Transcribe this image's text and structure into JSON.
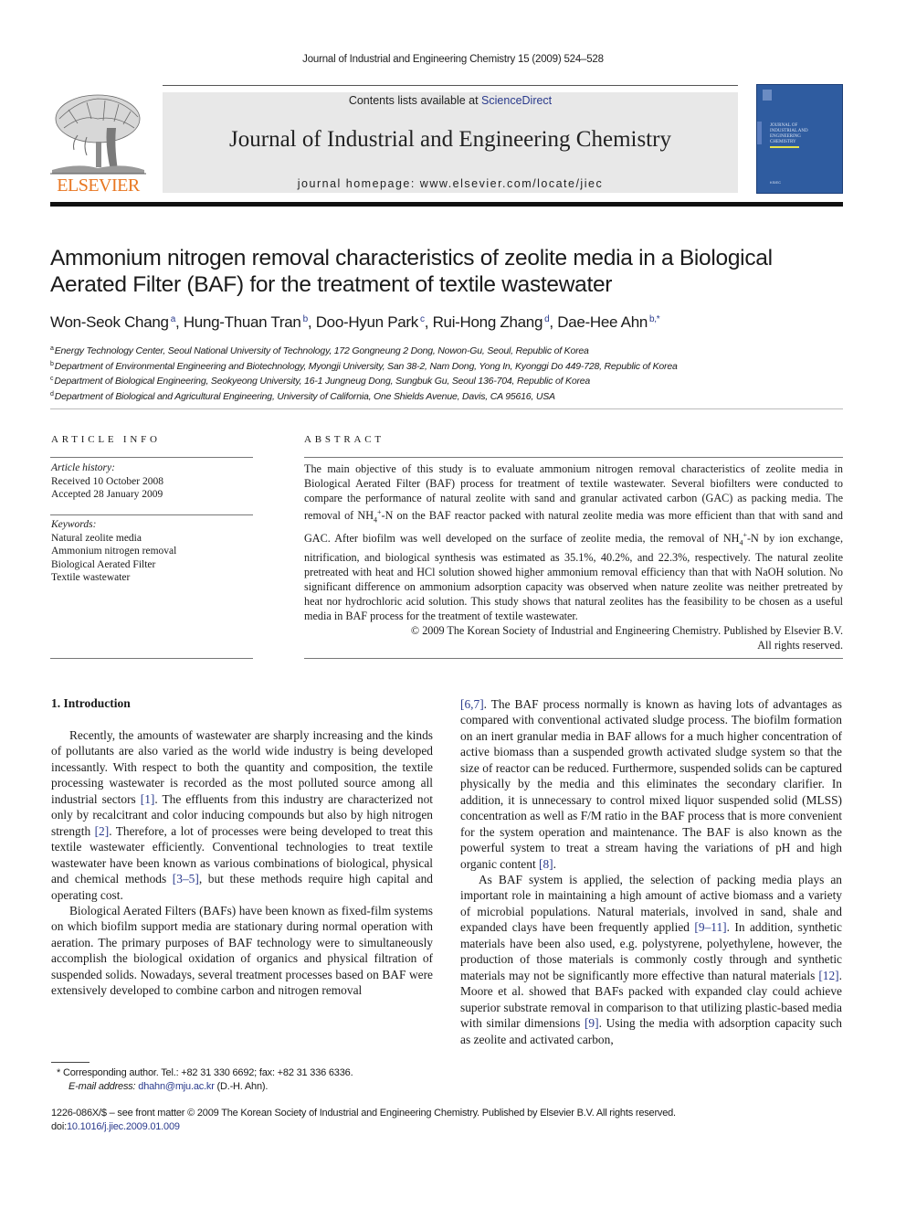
{
  "running_header": "Journal of Industrial and Engineering Chemistry 15 (2009) 524–528",
  "masthead": {
    "publisher_logo_text": "ELSEVIER",
    "contents_prefix": "Contents lists available at ",
    "contents_link": "ScienceDirect",
    "journal_title": "Journal of Industrial and Engineering Chemistry",
    "homepage": "journal homepage: www.elsevier.com/locate/jiec",
    "cover_title": "Journal of Industrial and Engineering Chemistry",
    "colors": {
      "logo_orange": "#e87722",
      "cover_blue": "#2f5ca0",
      "link_blue": "#2a3a8c",
      "banner_gray": "#e8e8e8"
    }
  },
  "article": {
    "title_line1": "Ammonium nitrogen removal characteristics of zeolite media in a Biological",
    "title_line2": "Aerated Filter (BAF) for the treatment of textile wastewater",
    "authors": [
      {
        "name": "Won-Seok Chang",
        "sup": "a",
        "sep": ", "
      },
      {
        "name": "Hung-Thuan Tran",
        "sup": "b",
        "sep": ", "
      },
      {
        "name": "Doo-Hyun Park",
        "sup": "c",
        "sep": ", "
      },
      {
        "name": "Rui-Hong Zhang",
        "sup": "d",
        "sep": ", "
      },
      {
        "name": "Dae-Hee Ahn",
        "sup": "b,*",
        "sep": ""
      }
    ],
    "affiliations": [
      {
        "key": "a",
        "text": "Energy Technology Center, Seoul National University of Technology, 172 Gongneung 2 Dong, Nowon-Gu, Seoul, Republic of Korea"
      },
      {
        "key": "b",
        "text": "Department of Environmental Engineering and Biotechnology, Myongji University, San 38-2, Nam Dong, Yong In, Kyonggi Do 449-728, Republic of Korea"
      },
      {
        "key": "c",
        "text": "Department of Biological Engineering, Seokyeong University, 16-1 Jungneug Dong, Sungbuk Gu, Seoul 136-704, Republic of Korea"
      },
      {
        "key": "d",
        "text": "Department of Biological and Agricultural Engineering, University of California, One Shields Avenue, Davis, CA 95616, USA"
      }
    ]
  },
  "article_info": {
    "heading": "ARTICLE INFO",
    "history_label": "Article history:",
    "received": "Received 10 October 2008",
    "accepted": "Accepted 28 January 2009",
    "keywords_label": "Keywords:",
    "keywords": [
      "Natural zeolite media",
      "Ammonium nitrogen removal",
      "Biological Aerated Filter",
      "Textile wastewater"
    ]
  },
  "abstract": {
    "heading": "ABSTRACT",
    "p1": "The main objective of this study is to evaluate ammonium nitrogen removal characteristics of zeolite media in Biological Aerated Filter (BAF) process for treatment of textile wastewater. Several biofilters were conducted to compare the performance of natural zeolite with sand and granular activated carbon (GAC) as packing media. The removal of ",
    "p2": " on the BAF reactor packed with natural zeolite media was more efficient than that with sand and GAC. After biofilm was well developed on the surface of zeolite media, the removal of ",
    "p3": " by ion exchange, nitrification, and biological synthesis was estimated as 35.1%, 40.2%, and 22.3%, respectively. The natural zeolite pretreated with heat and HCl solution showed higher ammonium removal efficiency than that with NaOH solution. No significant difference on ammonium adsorption capacity was observed when nature zeolite was neither pretreated by heat nor hydrochloric acid solution. This study shows that natural zeolites has the feasibility to be chosen as a useful media in BAF process for the treatment of textile wastewater.",
    "nh4_base": "NH",
    "nh4_sub": "4",
    "nh4_sup": "+",
    "nh4_suffix": "-N",
    "copyright_line1": "© 2009 The Korean Society of Industrial and Engineering Chemistry. Published by Elsevier B.V.",
    "copyright_line2": "All rights reserved."
  },
  "body": {
    "section_heading": "1.  Introduction",
    "left": {
      "p1_a": "Recently, the amounts of wastewater are sharply increasing and the kinds of pollutants are also varied as the world wide industry is being developed incessantly. With respect to both the quantity and composition, the textile processing wastewater is recorded as the most polluted source among all industrial sectors ",
      "ref1": "[1]",
      "p1_b": ". The effluents from this industry are characterized not only by recalcitrant and color inducing compounds but also by high nitrogen strength ",
      "ref2": "[2]",
      "p1_c": ". Therefore, a lot of processes were being developed to treat this textile wastewater efficiently. Conventional technologies to treat textile wastewater have been known as various combinations of biological, physical and chemical methods ",
      "ref3": "[3–5]",
      "p1_d": ", but these methods require high capital and operating cost.",
      "p2": "Biological Aerated Filters (BAFs) have been known as fixed-film systems on which biofilm support media are stationary during normal operation with aeration. The primary purposes of BAF technology were to simultaneously accomplish the biological oxidation of organics and physical filtration of suspended solids. Nowadays, several treatment processes based on BAF were extensively developed to combine carbon and nitrogen removal"
    },
    "right": {
      "ref67": "[6,7]",
      "p1_a": ". The BAF process normally is known as having lots of advantages as compared with conventional activated sludge process. The biofilm formation on an inert granular media in BAF allows for a much higher concentration of active biomass than a suspended growth activated sludge system so that the size of reactor can be reduced. Furthermore, suspended solids can be captured physically by the media and this eliminates the secondary clarifier. In addition, it is unnecessary to control mixed liquor suspended solid (MLSS) concentration as well as F/M ratio in the BAF process that is more convenient for the system operation and maintenance. The BAF is also known as the powerful system to treat a stream having the variations of pH and high organic content ",
      "ref8": "[8]",
      "p1_b": ".",
      "p2_a": "As BAF system is applied, the selection of packing media plays an important role in maintaining a high amount of active biomass and a variety of microbial populations. Natural materials, involved in sand, shale and expanded clays have been frequently applied ",
      "ref911": "[9–11]",
      "p2_b": ". In addition, synthetic materials have been also used, e.g. polystyrene, polyethylene, however, the production of those materials is commonly costly through and synthetic materials may not be significantly more effective than natural materials ",
      "ref12": "[12]",
      "p2_c": ". Moore et al. showed that BAFs packed with expanded clay could achieve superior substrate removal in comparison to that utilizing plastic-based media with similar dimensions ",
      "ref9": "[9]",
      "p2_d": ". Using the media with adsorption capacity such as zeolite and activated carbon,"
    }
  },
  "footnote": {
    "star": "*",
    "corresponding": "Corresponding author. Tel.: +82 31 330 6692; fax: +82 31 336 6336.",
    "email_label": "E-mail address:",
    "email": "dhahn@mju.ac.kr",
    "email_suffix": " (D.-H. Ahn)."
  },
  "bottom": {
    "issn_line": "1226-086X/$ – see front matter © 2009 The Korean Society of Industrial and Engineering Chemistry. Published by Elsevier B.V. All rights reserved.",
    "doi_prefix": "doi:",
    "doi": "10.1016/j.jiec.2009.01.009"
  }
}
